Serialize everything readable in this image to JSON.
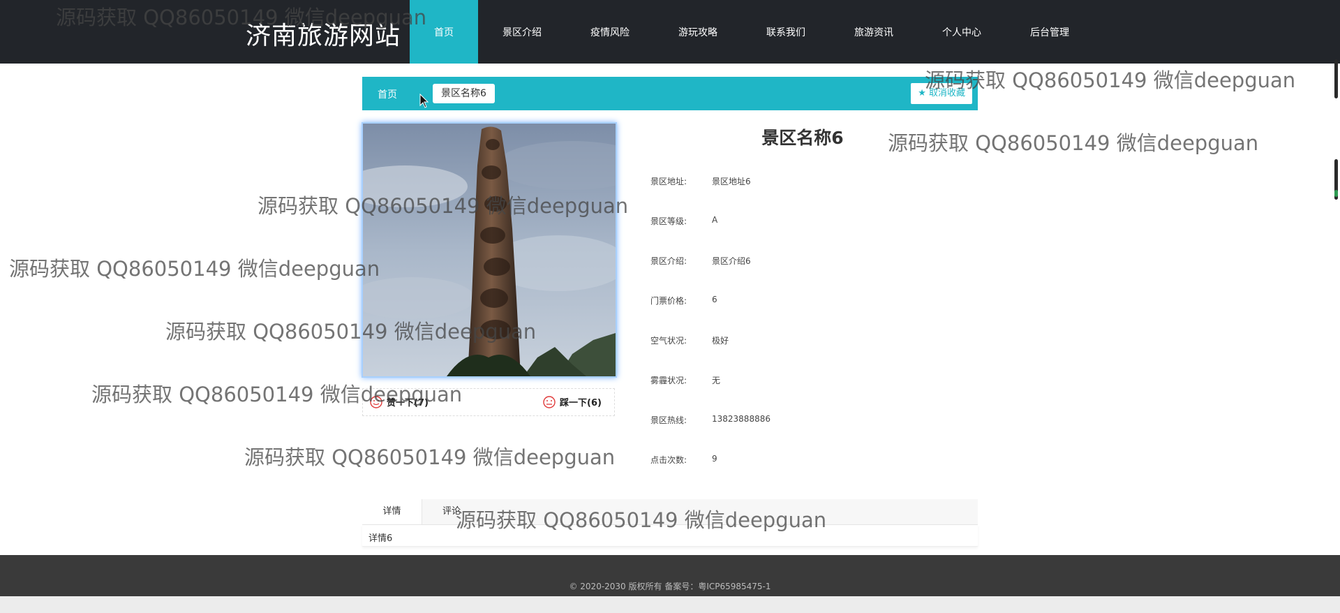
{
  "header": {
    "logo": "济南旅游网站",
    "nav": [
      "首页",
      "景区介绍",
      "疫情风险",
      "游玩攻略",
      "联系我们",
      "旅游资讯",
      "个人中心",
      "后台管理"
    ]
  },
  "breadcrumb": {
    "home": "首页",
    "current": "景区名称6",
    "favorite_button": "取消收藏"
  },
  "detail": {
    "title": "景区名称6",
    "fields": [
      {
        "label": "景区地址:",
        "value": "景区地址6"
      },
      {
        "label": "景区等级:",
        "value": "A"
      },
      {
        "label": "景区介绍:",
        "value": "景区介绍6"
      },
      {
        "label": "门票价格:",
        "value": "6"
      },
      {
        "label": "空气状况:",
        "value": "极好"
      },
      {
        "label": "雾霾状况:",
        "value": "无"
      },
      {
        "label": "景区热线:",
        "value": "13823888886"
      },
      {
        "label": "点击次数:",
        "value": "9"
      }
    ],
    "like": "赞一下(7)",
    "dislike": "踩一下(6)"
  },
  "tabs": {
    "items": [
      "详情",
      "评论"
    ],
    "content": "详情6"
  },
  "footer": {
    "text": "© 2020-2030 版权所有 备案号：粤ICP65985475-1"
  },
  "watermark": {
    "text": "源码获取 QQ86050149 微信deepguan"
  },
  "colors": {
    "accent": "#1fb6c6",
    "header_bg": "#22252a",
    "footer_bg": "#3a3a3a"
  }
}
